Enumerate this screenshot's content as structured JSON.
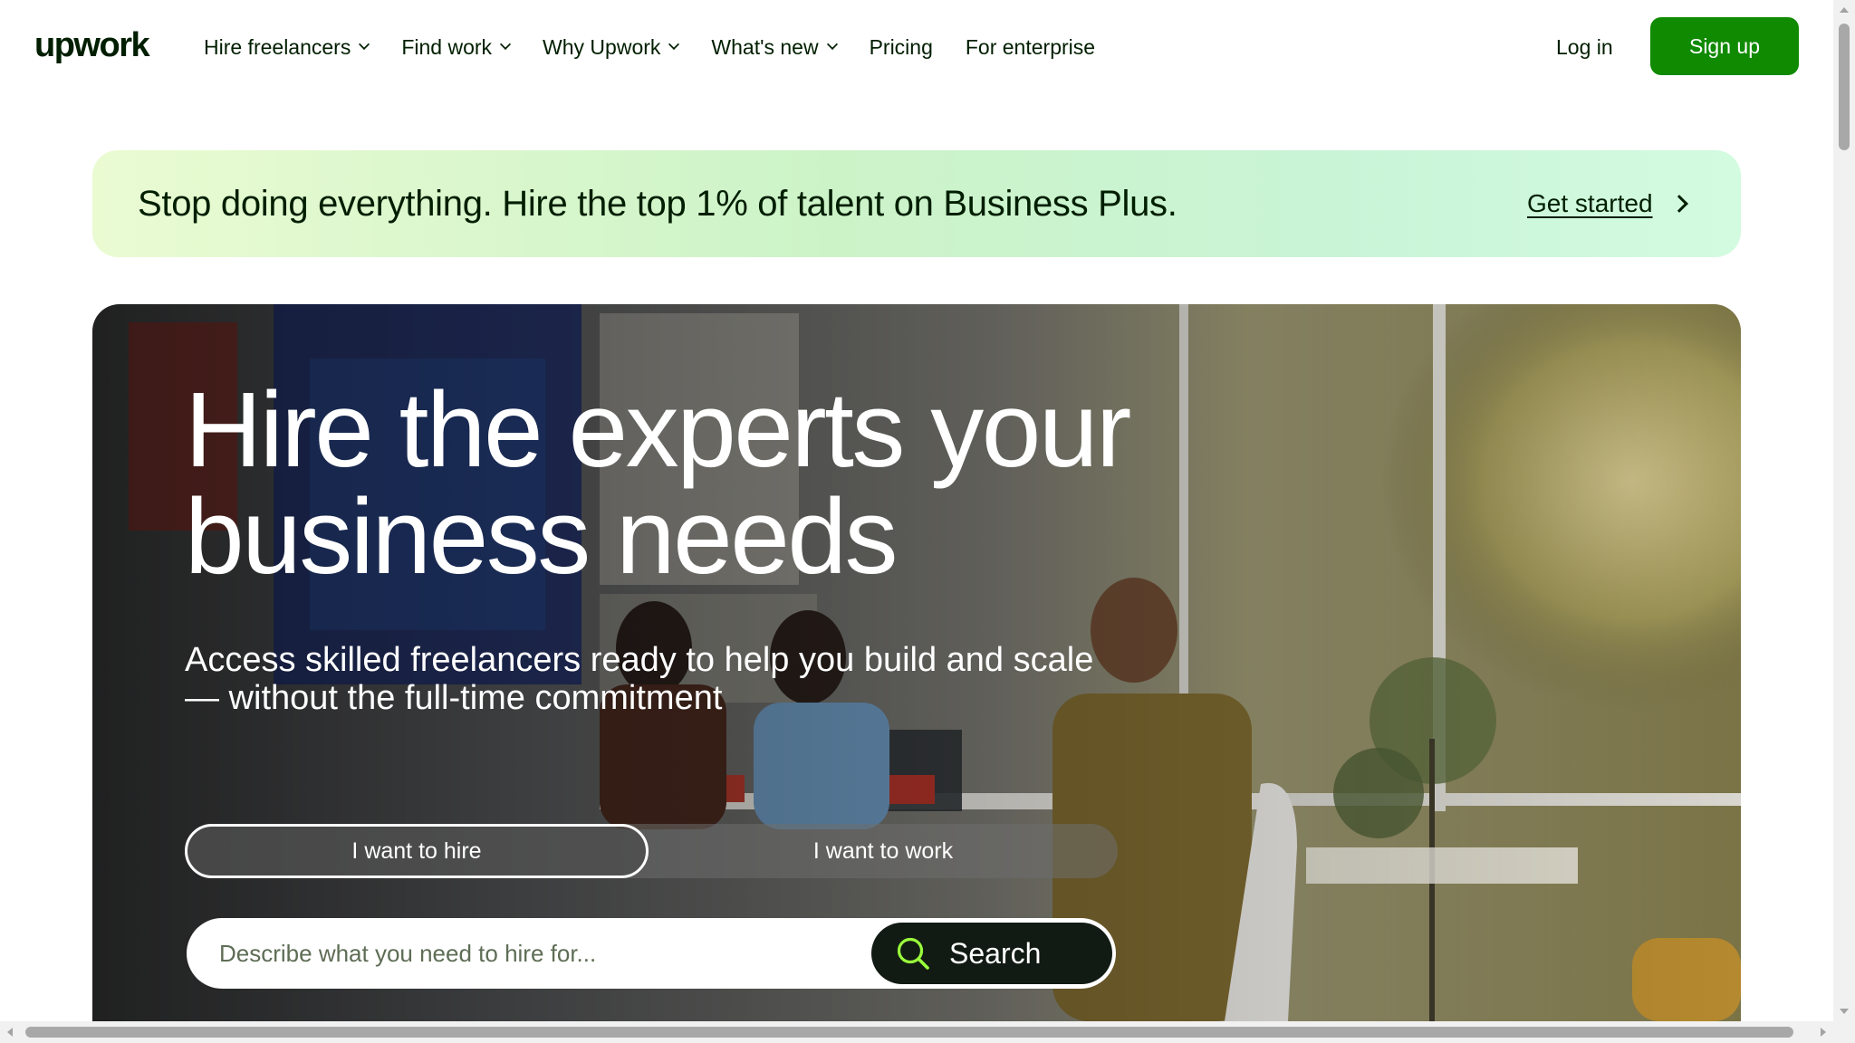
{
  "header": {
    "logo": "upwork",
    "nav": [
      {
        "label": "Hire freelancers",
        "dropdown": true
      },
      {
        "label": "Find work",
        "dropdown": true
      },
      {
        "label": "Why Upwork",
        "dropdown": true
      },
      {
        "label": "What's new",
        "dropdown": true
      },
      {
        "label": "Pricing",
        "dropdown": false
      },
      {
        "label": "For enterprise",
        "dropdown": false
      }
    ],
    "login_label": "Log in",
    "signup_label": "Sign up"
  },
  "promo": {
    "text": "Stop doing everything. Hire the top 1% of talent on Business Plus.",
    "link_label": "Get started",
    "link_icon": "chevron-right-icon"
  },
  "hero": {
    "title_line1": "Hire the experts your",
    "title_line2": "business needs",
    "subtitle_line1": "Access skilled freelancers ready to help you build and scale",
    "subtitle_line2": "— without the full-time commitment",
    "toggle": {
      "options": [
        "I want to hire",
        "I want to work"
      ],
      "selected": "I want to hire"
    },
    "search": {
      "placeholder": "Describe what you need to hire for...",
      "button_label": "Search",
      "button_icon": "search-icon"
    }
  },
  "colors": {
    "brand_green": "#108a00",
    "text_dark": "#001e00",
    "search_button": "#121b13",
    "search_icon": "#9aff3c"
  }
}
